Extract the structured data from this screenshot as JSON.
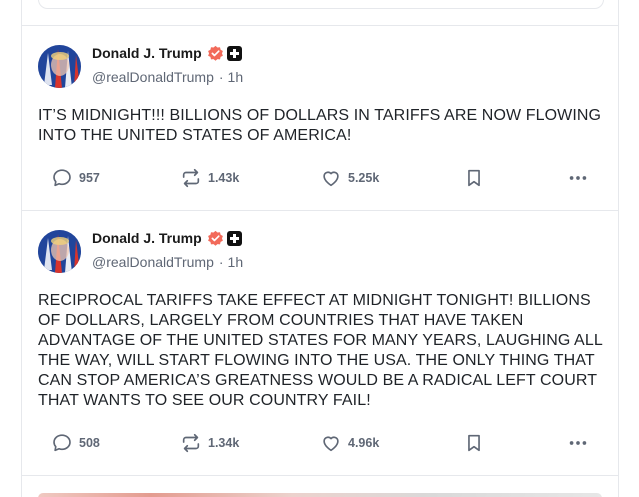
{
  "posts": [
    {
      "author": {
        "name": "Donald J. Trump",
        "handle": "@realDonaldTrump",
        "time": "1h"
      },
      "text": "IT’S MIDNIGHT!!! BILLIONS OF DOLLARS IN TARIFFS ARE NOW FLOWING INTO THE UNITED STATES OF AMERICA!",
      "stats": {
        "replies": "957",
        "retruths": "1.43k",
        "likes": "5.25k"
      }
    },
    {
      "author": {
        "name": "Donald J. Trump",
        "handle": "@realDonaldTrump",
        "time": "1h"
      },
      "text": "RECIPROCAL TARIFFS TAKE EFFECT AT MIDNIGHT TONIGHT! BILLIONS OF DOLLARS, LARGELY FROM COUNTRIES THAT HAVE TAKEN ADVANTAGE OF THE UNITED STATES FOR MANY YEARS, LAUGHING ALL THE WAY, WILL START FLOWING INTO THE USA. THE ONLY THING THAT CAN STOP AMERICA’S GREATNESS WOULD BE A RADICAL LEFT COURT THAT WANTS TO SEE OUR COUNTRY FAIL!",
      "stats": {
        "replies": "508",
        "retruths": "1.34k",
        "likes": "4.96k"
      }
    }
  ],
  "separator": "·",
  "colors": {
    "verified_badge": "#f26a5a",
    "text_muted": "#5f6775",
    "border": "#e6e8ec"
  },
  "icons": {
    "reply": "speech-bubble-icon",
    "retruth": "repost-arrows-icon",
    "like": "heart-icon",
    "bookmark": "bookmark-icon",
    "more": "more-dots-icon",
    "verified": "verified-badge-icon",
    "plus": "plus-badge-icon"
  }
}
